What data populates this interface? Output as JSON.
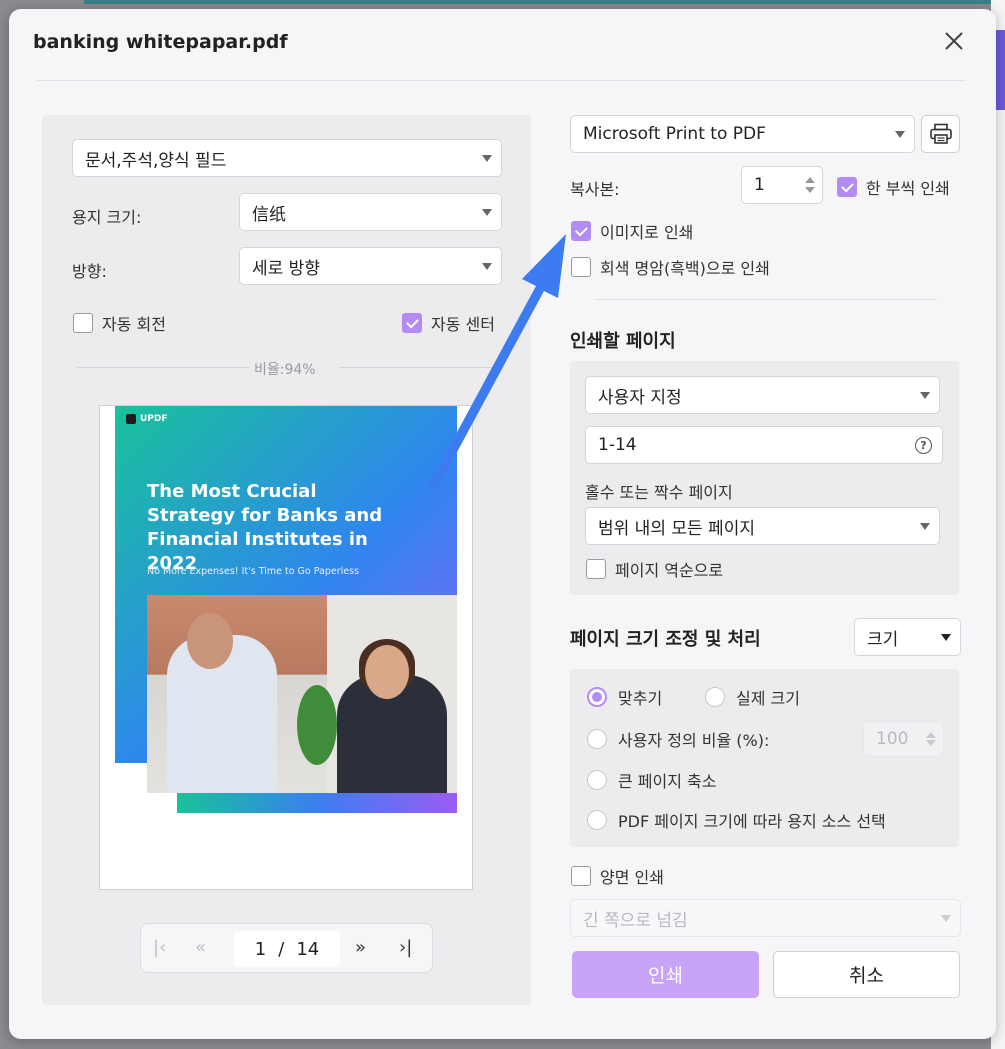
{
  "dialog": {
    "title": "banking whitepapar.pdf"
  },
  "left": {
    "content_select": "문서,주석,양식 필드",
    "paper_size_label": "용지 크기:",
    "paper_size_value": "信纸",
    "orientation_label": "방향:",
    "orientation_value": "세로 방향",
    "auto_rotate_label": "자동 회전",
    "auto_rotate_checked": false,
    "auto_center_label": "자동 센터",
    "auto_center_checked": true,
    "ratio_text": "비율:94%"
  },
  "preview_doc": {
    "logo_text": "UPDF",
    "title": "The Most Crucial Strategy for Banks and Financial Institutes in 2022",
    "subtitle": "No More Expenses! It's Time to Go Paperless"
  },
  "pager": {
    "current": "1",
    "separator": "/",
    "total": "14"
  },
  "right": {
    "printer": "Microsoft Print to PDF",
    "copies_label": "복사본:",
    "copies_value": "1",
    "collate_label": "한 부씩 인쇄",
    "collate_checked": true,
    "print_as_image_label": "이미지로 인쇄",
    "print_as_image_checked": true,
    "grayscale_label": "회색 명암(흑백)으로 인쇄",
    "grayscale_checked": false,
    "pages_heading": "인쇄할 페이지",
    "pages_mode": "사용자 지정",
    "pages_range": "1-14",
    "odd_even_label": "홀수 또는 짝수 페이지",
    "odd_even_value": "범위 내의 모든 페이지",
    "reverse_label": "페이지 역순으로",
    "reverse_checked": false,
    "sizing_heading": "페이지 크기 조정 및 처리",
    "sizing_select": "크기",
    "fit_label": "맞추기",
    "actual_size_label": "실제 크기",
    "custom_scale_label": "사용자 정의 비율 (%):",
    "custom_scale_value": "100",
    "shrink_label": "큰 페이지 축소",
    "paper_source_label": "PDF 페이지 크기에 따라 용지 소스 선택",
    "duplex_label": "양면 인쇄",
    "duplex_checked": false,
    "flip_value": "긴 쪽으로 넘김",
    "print_button": "인쇄",
    "cancel_button": "취소"
  },
  "colors": {
    "accent": "#b28cf2",
    "print_button": "#c9a3f7",
    "arrow": "#3d7cf0"
  }
}
